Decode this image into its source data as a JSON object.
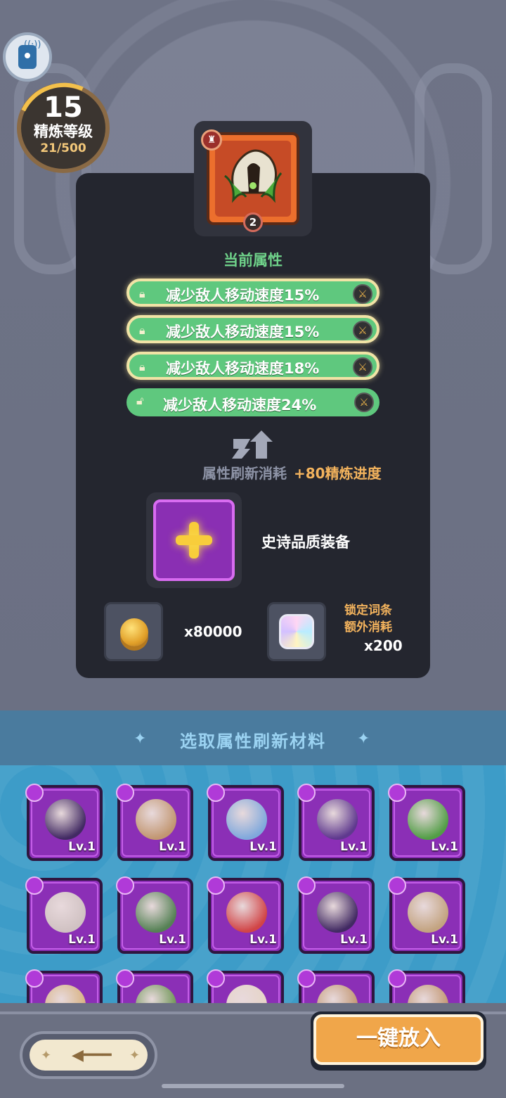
{
  "level": {
    "value": "15",
    "label": "精炼等级",
    "progress_text": "21/500",
    "progress_fraction": 0.042
  },
  "current_equipment": {
    "count": "2",
    "rarity_color": "#ec6f2d"
  },
  "attributes": {
    "title": "当前属性",
    "items": [
      {
        "text": "减少敌人移动速度15%",
        "locked": true
      },
      {
        "text": "减少敌人移动速度15%",
        "locked": true
      },
      {
        "text": "减少敌人移动速度18%",
        "locked": true
      },
      {
        "text": "减少敌人移动速度24%",
        "locked": false
      }
    ]
  },
  "refresh": {
    "cost_label": "属性刷新消耗",
    "cost_bonus": "+80精炼进度"
  },
  "material": {
    "label": "史诗品质装备"
  },
  "costs": {
    "coin_amount": "x80000",
    "lock_label_line1": "锁定词条",
    "lock_label_line2": "额外消耗",
    "lock_amount": "x200"
  },
  "select": {
    "title": "选取属性刷新材料"
  },
  "items": [
    {
      "lv": "Lv.1"
    },
    {
      "lv": "Lv.1"
    },
    {
      "lv": "Lv.1"
    },
    {
      "lv": "Lv.1"
    },
    {
      "lv": "Lv.1"
    },
    {
      "lv": "Lv.1"
    },
    {
      "lv": "Lv.1"
    },
    {
      "lv": "Lv.1"
    },
    {
      "lv": "Lv.1"
    },
    {
      "lv": "Lv.1"
    },
    {
      "lv": ""
    },
    {
      "lv": ""
    },
    {
      "lv": ""
    },
    {
      "lv": ""
    },
    {
      "lv": ""
    }
  ],
  "buttons": {
    "put_all": "一键放入"
  },
  "colors": {
    "attr_green": "#5fc87e",
    "gold_text": "#f3b35d",
    "epic_purple": "#8b2fb6",
    "accent_orange": "#f0a64a"
  },
  "icons": [
    "signal-camera-icon",
    "lock-icon",
    "sword-icon",
    "refresh-arrow-icon",
    "plus-icon",
    "coin-icon",
    "gem-icon",
    "back-arrow-icon"
  ]
}
